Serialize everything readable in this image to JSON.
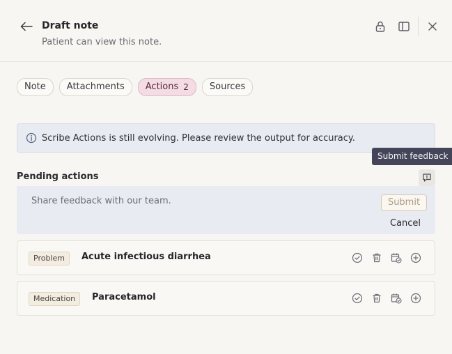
{
  "header": {
    "title": "Draft note",
    "subtitle": "Patient can view this note."
  },
  "tabs": [
    {
      "label": "Note"
    },
    {
      "label": "Attachments"
    },
    {
      "label": "Actions",
      "count": "2",
      "active": true
    },
    {
      "label": "Sources"
    }
  ],
  "banner": {
    "text": "Scribe Actions is still evolving. Please review the output for accuracy."
  },
  "tooltip": {
    "text": "Submit feedback"
  },
  "pending": {
    "title": "Pending actions",
    "feedback": {
      "placeholder": "Share feedback with our team.",
      "submit_label": "Submit",
      "cancel_label": "Cancel"
    },
    "items": [
      {
        "tag": "Problem",
        "title": "Acute infectious diarrhea"
      },
      {
        "tag": "Medication",
        "title": "Paracetamol"
      }
    ]
  },
  "icons": {
    "back": "arrow-left-icon",
    "lock": "lock-icon",
    "sidebar": "sidebar-panel-icon",
    "close": "close-icon",
    "info": "info-icon",
    "feedback": "message-square-icon",
    "accept": "check-circle-icon",
    "delete": "trash-icon",
    "schedule": "calendar-check-icon",
    "add": "plus-circle-icon"
  },
  "colors": {
    "background": "#f7f6f2",
    "active_tab": "#f4dce5",
    "banner": "#e8ebf1",
    "tooltip": "#45455a"
  }
}
